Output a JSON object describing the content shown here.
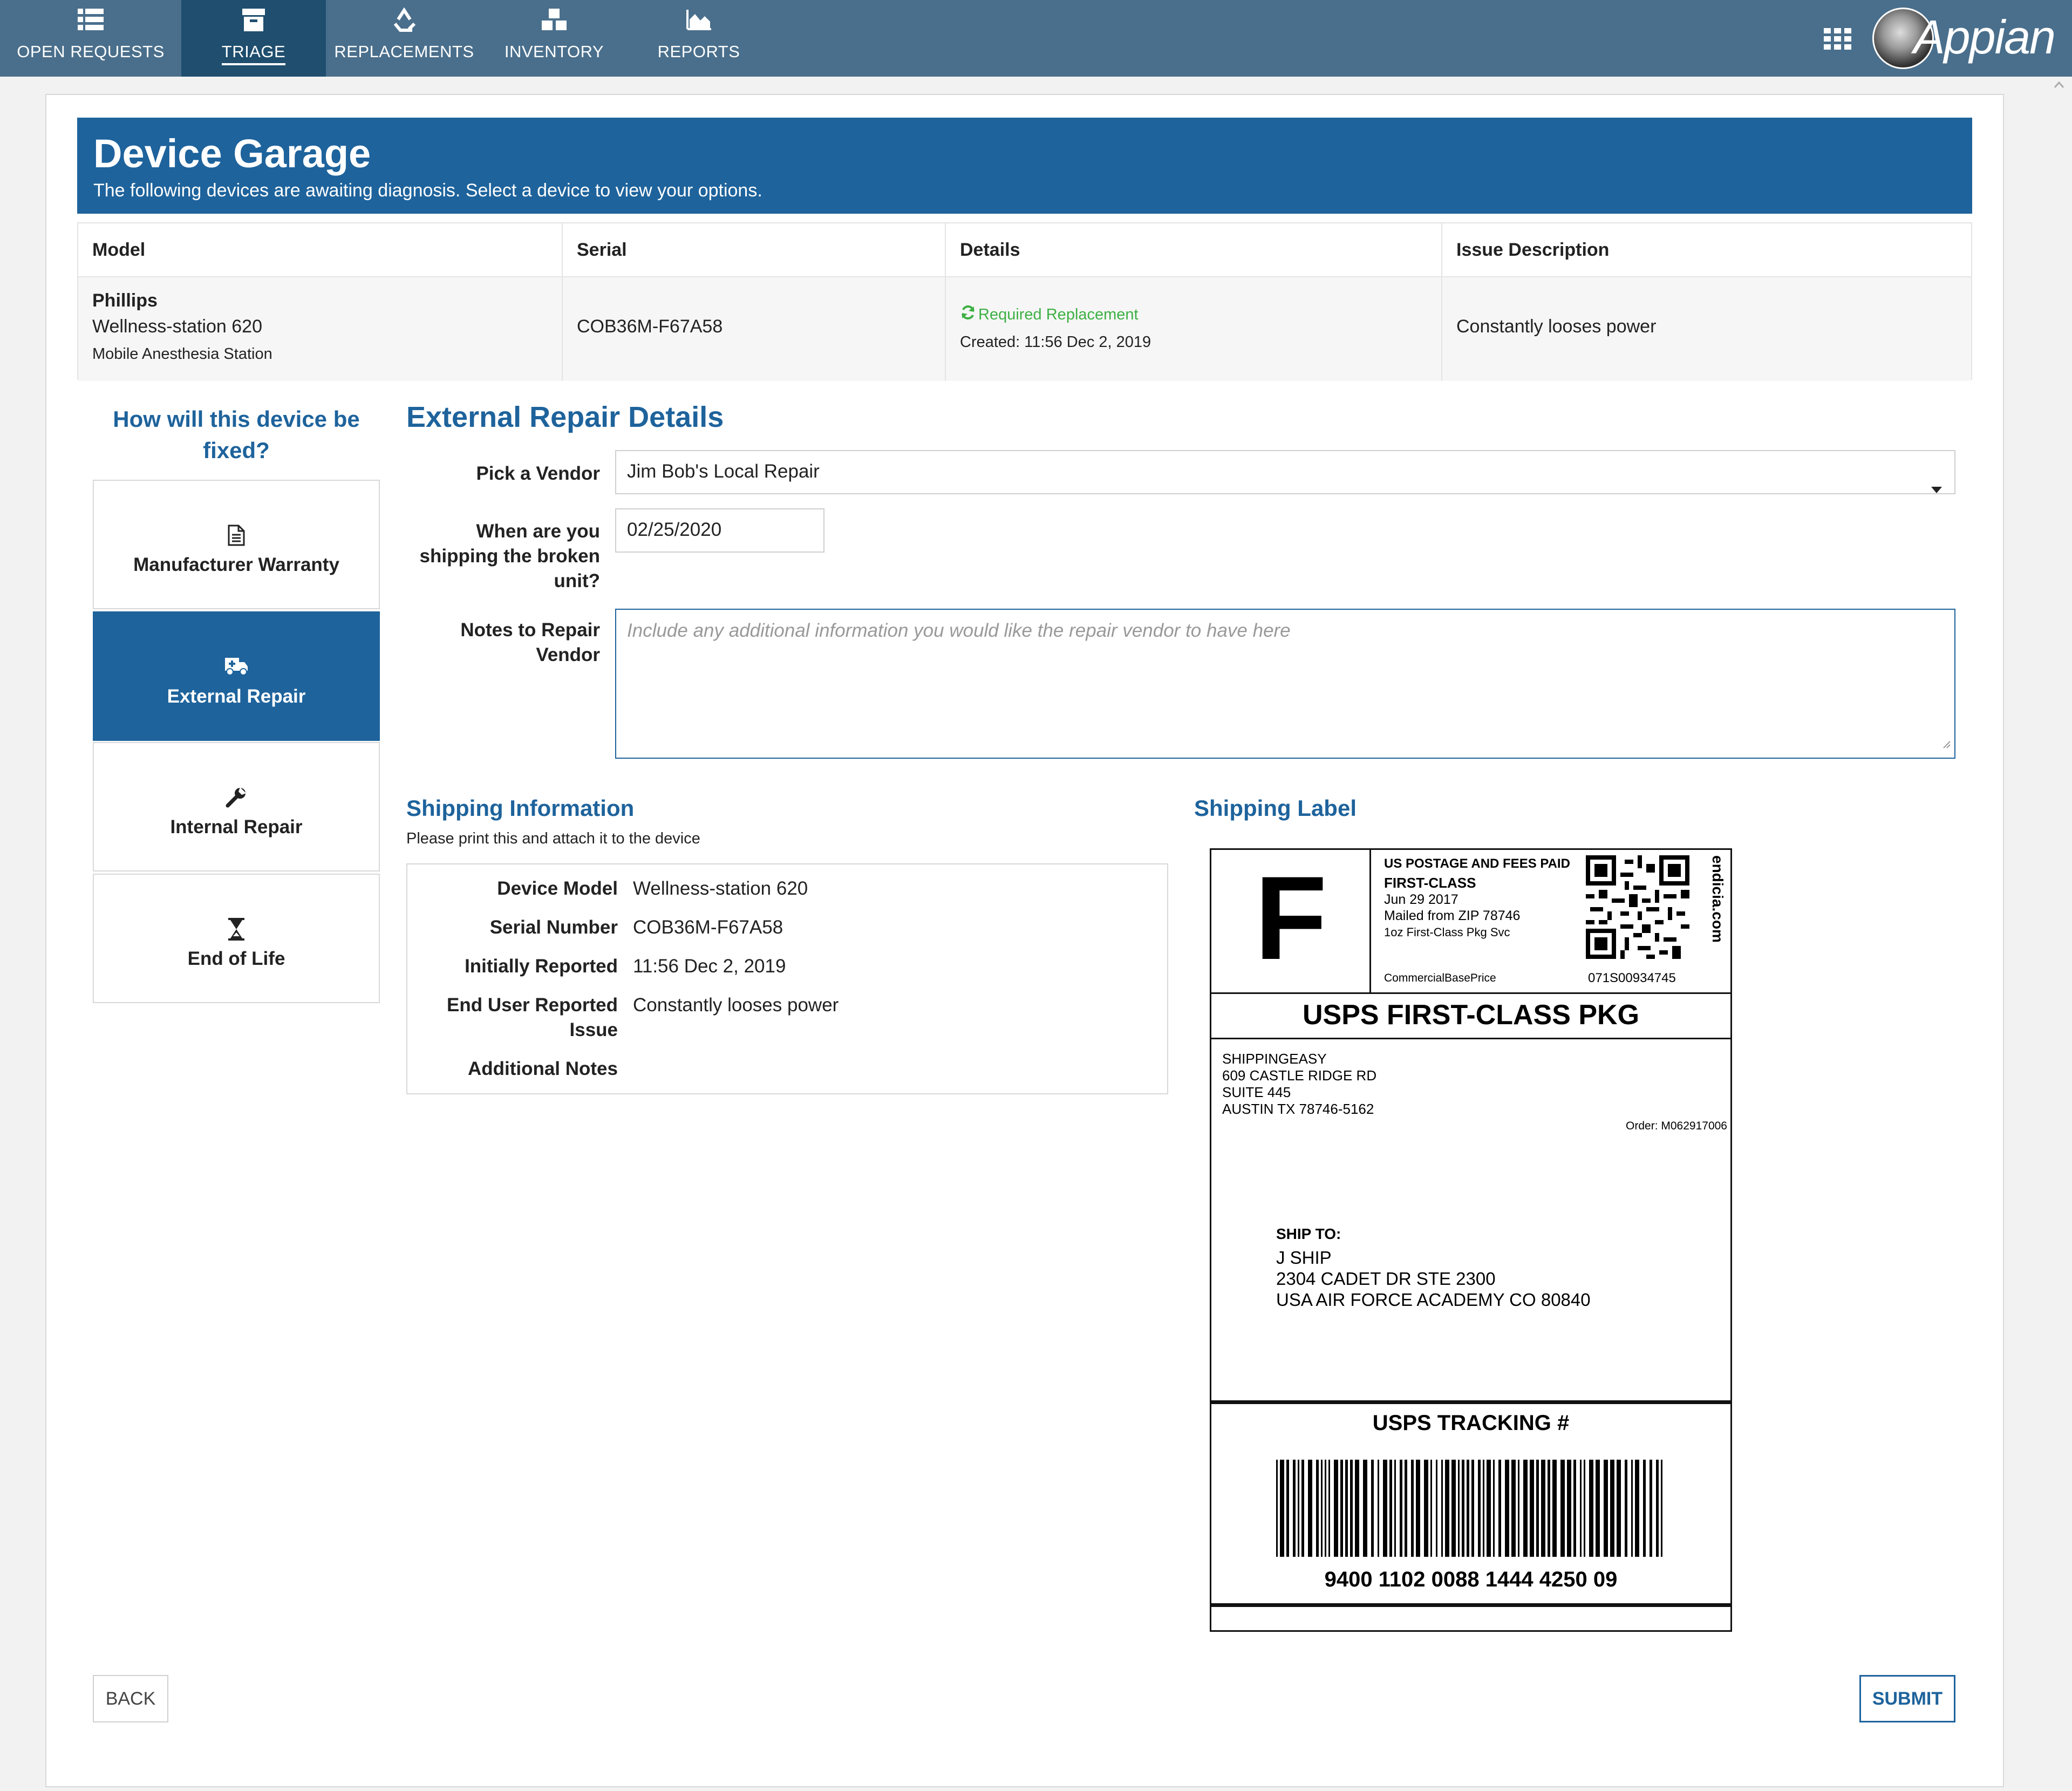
{
  "nav": {
    "tabs": [
      {
        "label": "OPEN REQUESTS",
        "icon": "list-icon"
      },
      {
        "label": "TRIAGE",
        "icon": "archive-icon",
        "active": true
      },
      {
        "label": "REPLACEMENTS",
        "icon": "recycle-icon"
      },
      {
        "label": "INVENTORY",
        "icon": "cubes-icon"
      },
      {
        "label": "REPORTS",
        "icon": "area-chart-icon"
      }
    ],
    "brand": "Appian"
  },
  "banner": {
    "title": "Device Garage",
    "subtitle": "The following devices are awaiting diagnosis.  Select a device to view your options."
  },
  "table": {
    "headers": [
      "Model",
      "Serial",
      "Details",
      "Issue Description"
    ],
    "row": {
      "manufacturer": "Phillips",
      "model": "Wellness-station 620",
      "type": "Mobile Anesthesia Station",
      "serial": "COB36M-F67A58",
      "status": "Required Replacement",
      "created": "Created: 11:56 Dec 2, 2019",
      "issue": "Constantly looses power"
    }
  },
  "options": {
    "heading": "How will this device be fixed?",
    "items": [
      {
        "label": "Manufacturer Warranty",
        "icon": "file-icon"
      },
      {
        "label": "External Repair",
        "icon": "ambulance-icon",
        "selected": true
      },
      {
        "label": "Internal Repair",
        "icon": "wrench-icon"
      },
      {
        "label": "End of Life",
        "icon": "hourglass-icon"
      }
    ]
  },
  "form": {
    "heading": "External Repair Details",
    "vendor_label": "Pick a Vendor",
    "vendor_value": "Jim Bob's Local Repair",
    "ship_date_label": "When are you shipping the broken unit?",
    "ship_date_value": "02/25/2020",
    "notes_label": "Notes to Repair Vendor",
    "notes_placeholder": "Include any additional information you would like the repair vendor to have here"
  },
  "shipping": {
    "heading": "Shipping Information",
    "subtitle": "Please print this and attach it to the device",
    "rows": [
      {
        "label": "Device Model",
        "value": "Wellness-station 620"
      },
      {
        "label": "Serial Number",
        "value": "COB36M-F67A58"
      },
      {
        "label": "Initially Reported",
        "value": "11:56 Dec 2, 2019"
      },
      {
        "label": "End User Reported Issue",
        "value": "Constantly looses power"
      },
      {
        "label": "Additional Notes",
        "value": ""
      }
    ]
  },
  "label": {
    "heading": "Shipping Label",
    "class_letter": "F",
    "postage_line1": "US POSTAGE AND FEES PAID",
    "postage_line2": "FIRST-CLASS",
    "date": "Jun 29 2017",
    "mailed_from": "Mailed from ZIP 78746",
    "service": "1oz First-Class Pkg Svc",
    "price": "CommercialBasePrice",
    "code": "071S00934745",
    "vendor": "endicia.com",
    "service_title": "USPS FIRST-CLASS PKG",
    "from": [
      "SHIPPINGEASY",
      "609 CASTLE RIDGE RD",
      "SUITE 445",
      "AUSTIN TX 78746-5162"
    ],
    "order": "Order: M062917006",
    "ship_to_label": "SHIP TO:",
    "ship_to": [
      "J SHIP",
      "2304 CADET DR STE 2300",
      "USA AIR FORCE ACADEMY CO 80840"
    ],
    "tracking_title": "USPS TRACKING #",
    "tracking_number": "9400 1102 0088 1444 4250 09"
  },
  "buttons": {
    "back": "BACK",
    "submit": "SUBMIT"
  },
  "colors": {
    "nav": "#4a6f8c",
    "nav_active": "#1f4e6e",
    "primary": "#1e639c",
    "status_green": "#3cb043"
  }
}
